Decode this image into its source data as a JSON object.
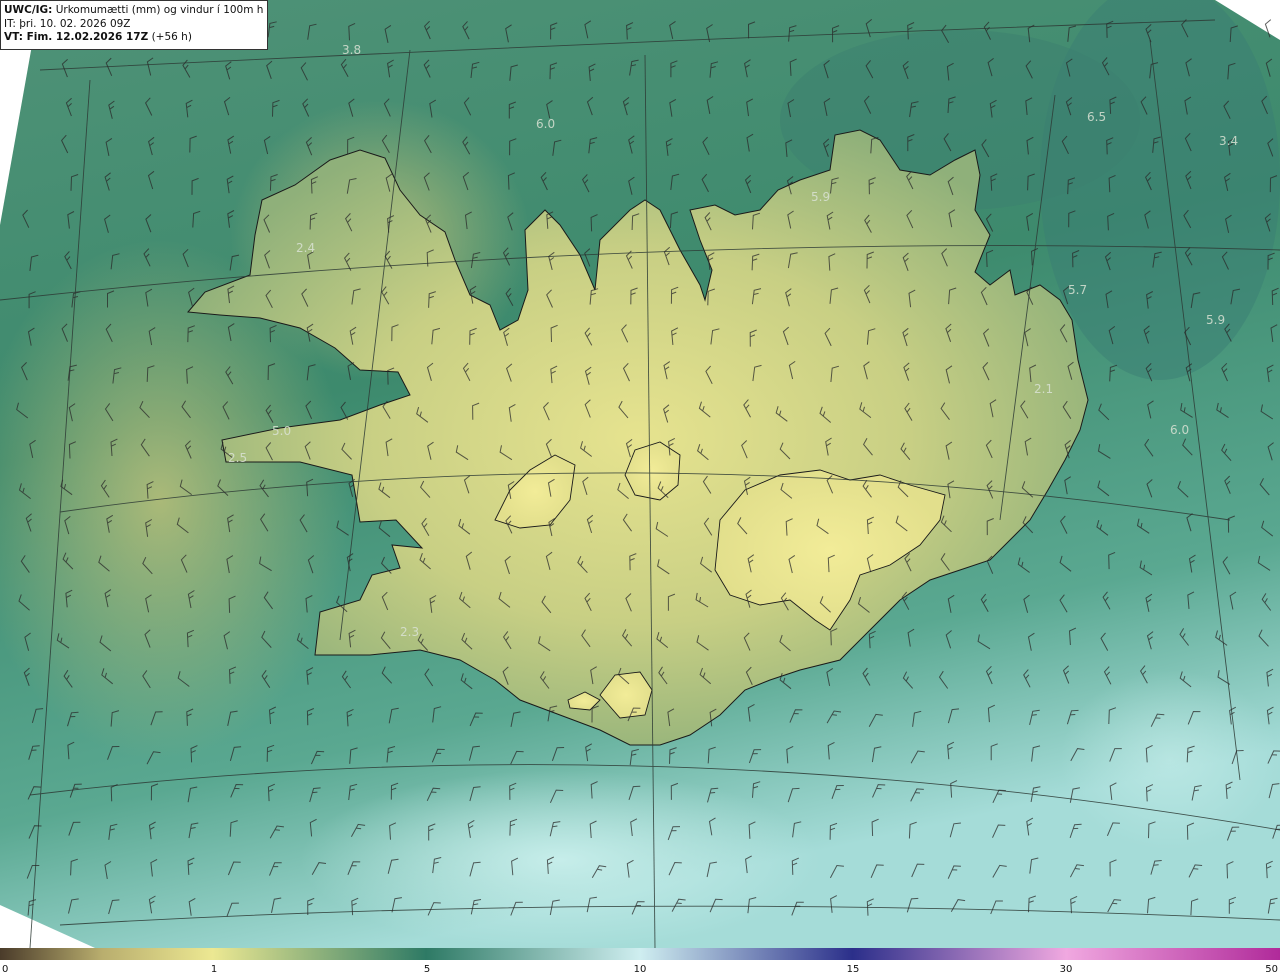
{
  "title": {
    "model": "UWC/IG:",
    "product": "Úrkomumætti (mm) og vindur í 100m hæð",
    "initial_time": "IT: þri. 10. 02. 2026 09Z",
    "valid_label": "VT: Fim. 12.02.2026 17Z",
    "valid_offset": "(+56 h)"
  },
  "map_labels": [
    {
      "text": "3.8"
    },
    {
      "text": "6.0"
    },
    {
      "text": "6.5"
    },
    {
      "text": "3.4"
    },
    {
      "text": "5.9"
    },
    {
      "text": "2.4"
    },
    {
      "text": "5.7"
    },
    {
      "text": "5.9"
    },
    {
      "text": "2.1"
    },
    {
      "text": "5.0"
    },
    {
      "text": "6.0"
    },
    {
      "text": "2.5"
    },
    {
      "text": "2.3"
    }
  ],
  "colorbar": {
    "ticks": [
      "0",
      "1",
      "5",
      "10",
      "15",
      "30",
      "50"
    ],
    "colors": {
      "low": "#4a3b2a",
      "dry": "#b9ae6e",
      "one": "#ece892",
      "five": "#2e7a65",
      "ten": "#cfeef0",
      "fifteen": "#2b2f8a",
      "thirty": "#f0a8e0",
      "fifty": "#b02a9a"
    }
  },
  "palette": {
    "sea": "#3f8a6e",
    "land": "#d9d88a",
    "coast": "#1a1a1a",
    "barb": "#2a2a2a",
    "grid": "#2d3a35"
  }
}
